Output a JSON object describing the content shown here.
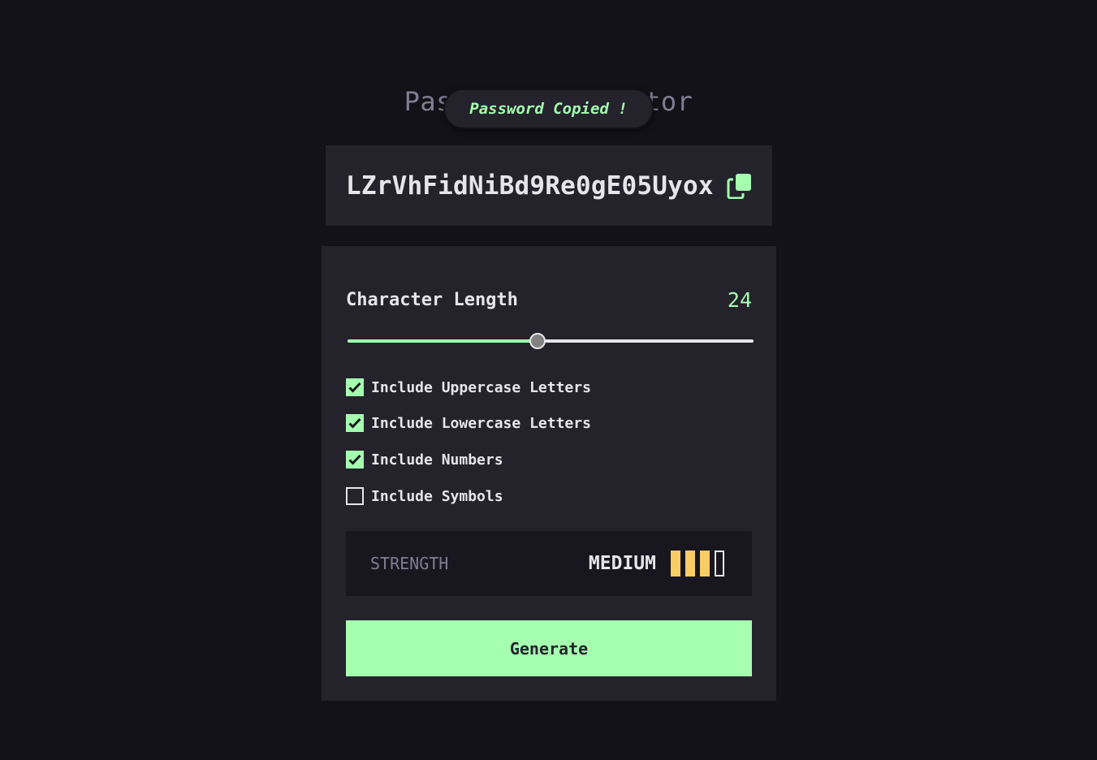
{
  "app": {
    "title": "Password Generator"
  },
  "toast": {
    "message": "Password Copied !"
  },
  "output": {
    "password": "LZrVhFidNiBd9Re0gE05Uyox",
    "copy_icon": "copy-icon"
  },
  "settings": {
    "length_label": "Character Length",
    "length_value": "24",
    "slider_fraction": 0.468,
    "options": [
      {
        "label": "Include Uppercase Letters",
        "checked": true
      },
      {
        "label": "Include Lowercase Letters",
        "checked": true
      },
      {
        "label": "Include Numbers",
        "checked": true
      },
      {
        "label": "Include Symbols",
        "checked": false
      }
    ]
  },
  "strength": {
    "label": "STRENGTH",
    "value": "MEDIUM",
    "level": 3,
    "max_level": 4
  },
  "generate": {
    "label": "Generate"
  },
  "colors": {
    "accent": "#a4ffaf",
    "strength_medium": "#f8cd65",
    "background": "#131219",
    "panel": "#24232c"
  }
}
